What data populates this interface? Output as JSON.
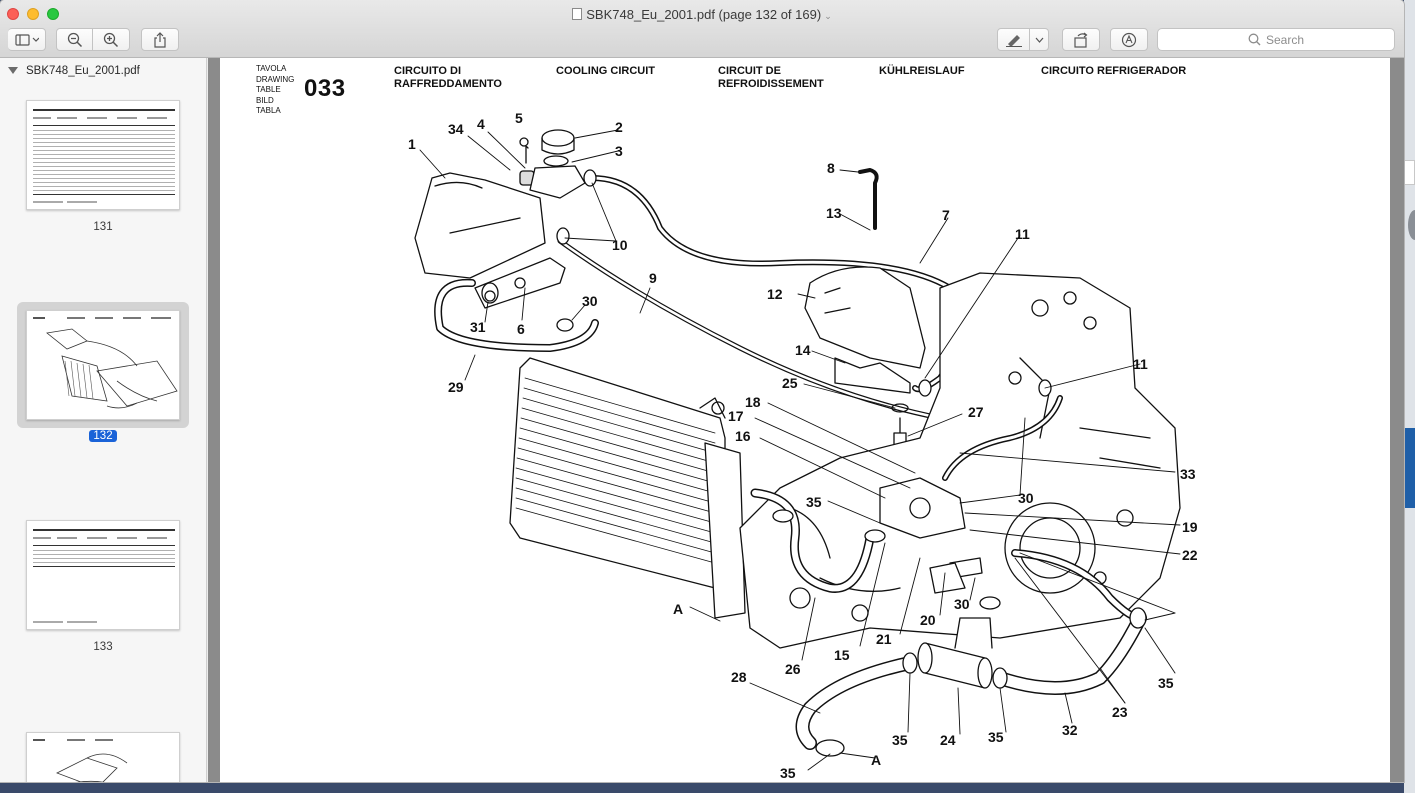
{
  "window": {
    "title": "SBK748_Eu_2001.pdf (page 132 of 169)"
  },
  "toolbar": {
    "search_placeholder": "Search"
  },
  "sidebar": {
    "document_name": "SBK748_Eu_2001.pdf",
    "thumbnails": [
      {
        "label": "131"
      },
      {
        "label": "132",
        "selected": true
      },
      {
        "label": "133"
      }
    ]
  },
  "page": {
    "header_label_lines": [
      "TAVOLA",
      "DRAWING",
      "TABLE",
      "BILD",
      "TABLA"
    ],
    "table_number": "033",
    "titles": [
      {
        "lines": [
          "CIRCUITO DI",
          "RAFFREDDAMENTO"
        ]
      },
      {
        "lines": [
          "COOLING CIRCUIT"
        ]
      },
      {
        "lines": [
          "CIRCUIT DE",
          "REFROIDISSEMENT"
        ]
      },
      {
        "lines": [
          "KÜHLREISLAUF"
        ]
      },
      {
        "lines": [
          "CIRCUITO REFRIGERADOR"
        ]
      }
    ],
    "callouts": [
      "1",
      "34",
      "4",
      "5",
      "2",
      "3",
      "10",
      "8",
      "13",
      "7",
      "11",
      "9",
      "12",
      "30",
      "31",
      "6",
      "29",
      "14",
      "25",
      "27",
      "11",
      "18",
      "17",
      "16",
      "33",
      "30",
      "19",
      "22",
      "35",
      "30",
      "20",
      "21",
      "15",
      "26",
      "A",
      "28",
      "35",
      "24",
      "35",
      "32",
      "23",
      "35",
      "35",
      "A"
    ]
  },
  "icon_names": [
    "sidebar-toggle-icon",
    "zoom-out-icon",
    "zoom-in-icon",
    "share-icon",
    "markup-pen-icon",
    "rotate-icon",
    "annotate-icon",
    "search-icon"
  ]
}
